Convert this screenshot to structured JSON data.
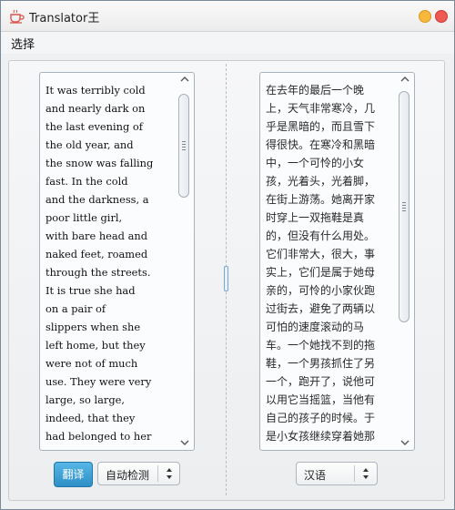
{
  "window": {
    "title": "Translator王",
    "app_icon": "teacup-icon"
  },
  "menubar": {
    "items": [
      "选择"
    ]
  },
  "source_pane": {
    "text": "It was terribly cold\nand nearly dark on\nthe last evening of\nthe old year, and\nthe snow was falling\nfast. In the cold\nand the darkness, a\npoor little girl,\nwith bare head and\nnaked feet, roamed\nthrough the streets.\nIt is true she had\non a pair of\nslippers when she\nleft home, but they\nwere not of much\nuse. They were very\nlarge, so large,\nindeed, that they\nhad belonged to her"
  },
  "target_pane": {
    "text": "在去年的最后一个晚\n上，天气非常寒冷，几\n乎是黑暗的，而且雪下\n得很快。在寒冷和黑暗\n中，一个可怜的小女\n孩，光着头，光着脚，\n在街上游荡。她离开家\n时穿上一双拖鞋是真\n的，但没有什么用处。\n它们非常大，很大，事\n实上，它们是属于她母\n亲的，可怜的小家伙跑\n过街去，避免了两辆以\n可怕的速度滚动的马\n车。一个她找不到的拖\n鞋，一个男孩抓住了另\n一个，跑开了，说他可\n以用它当摇篮，当他有\n自己的孩子的时候。于\n是小女孩继续穿着她那"
  },
  "controls": {
    "translate_label": "翻译",
    "source_language": "自动检测",
    "target_language": "汉语"
  },
  "colors": {
    "translate_button": "#2d8fc5",
    "close_button": "#ee5a52",
    "minimize_button": "#f7b83d"
  }
}
